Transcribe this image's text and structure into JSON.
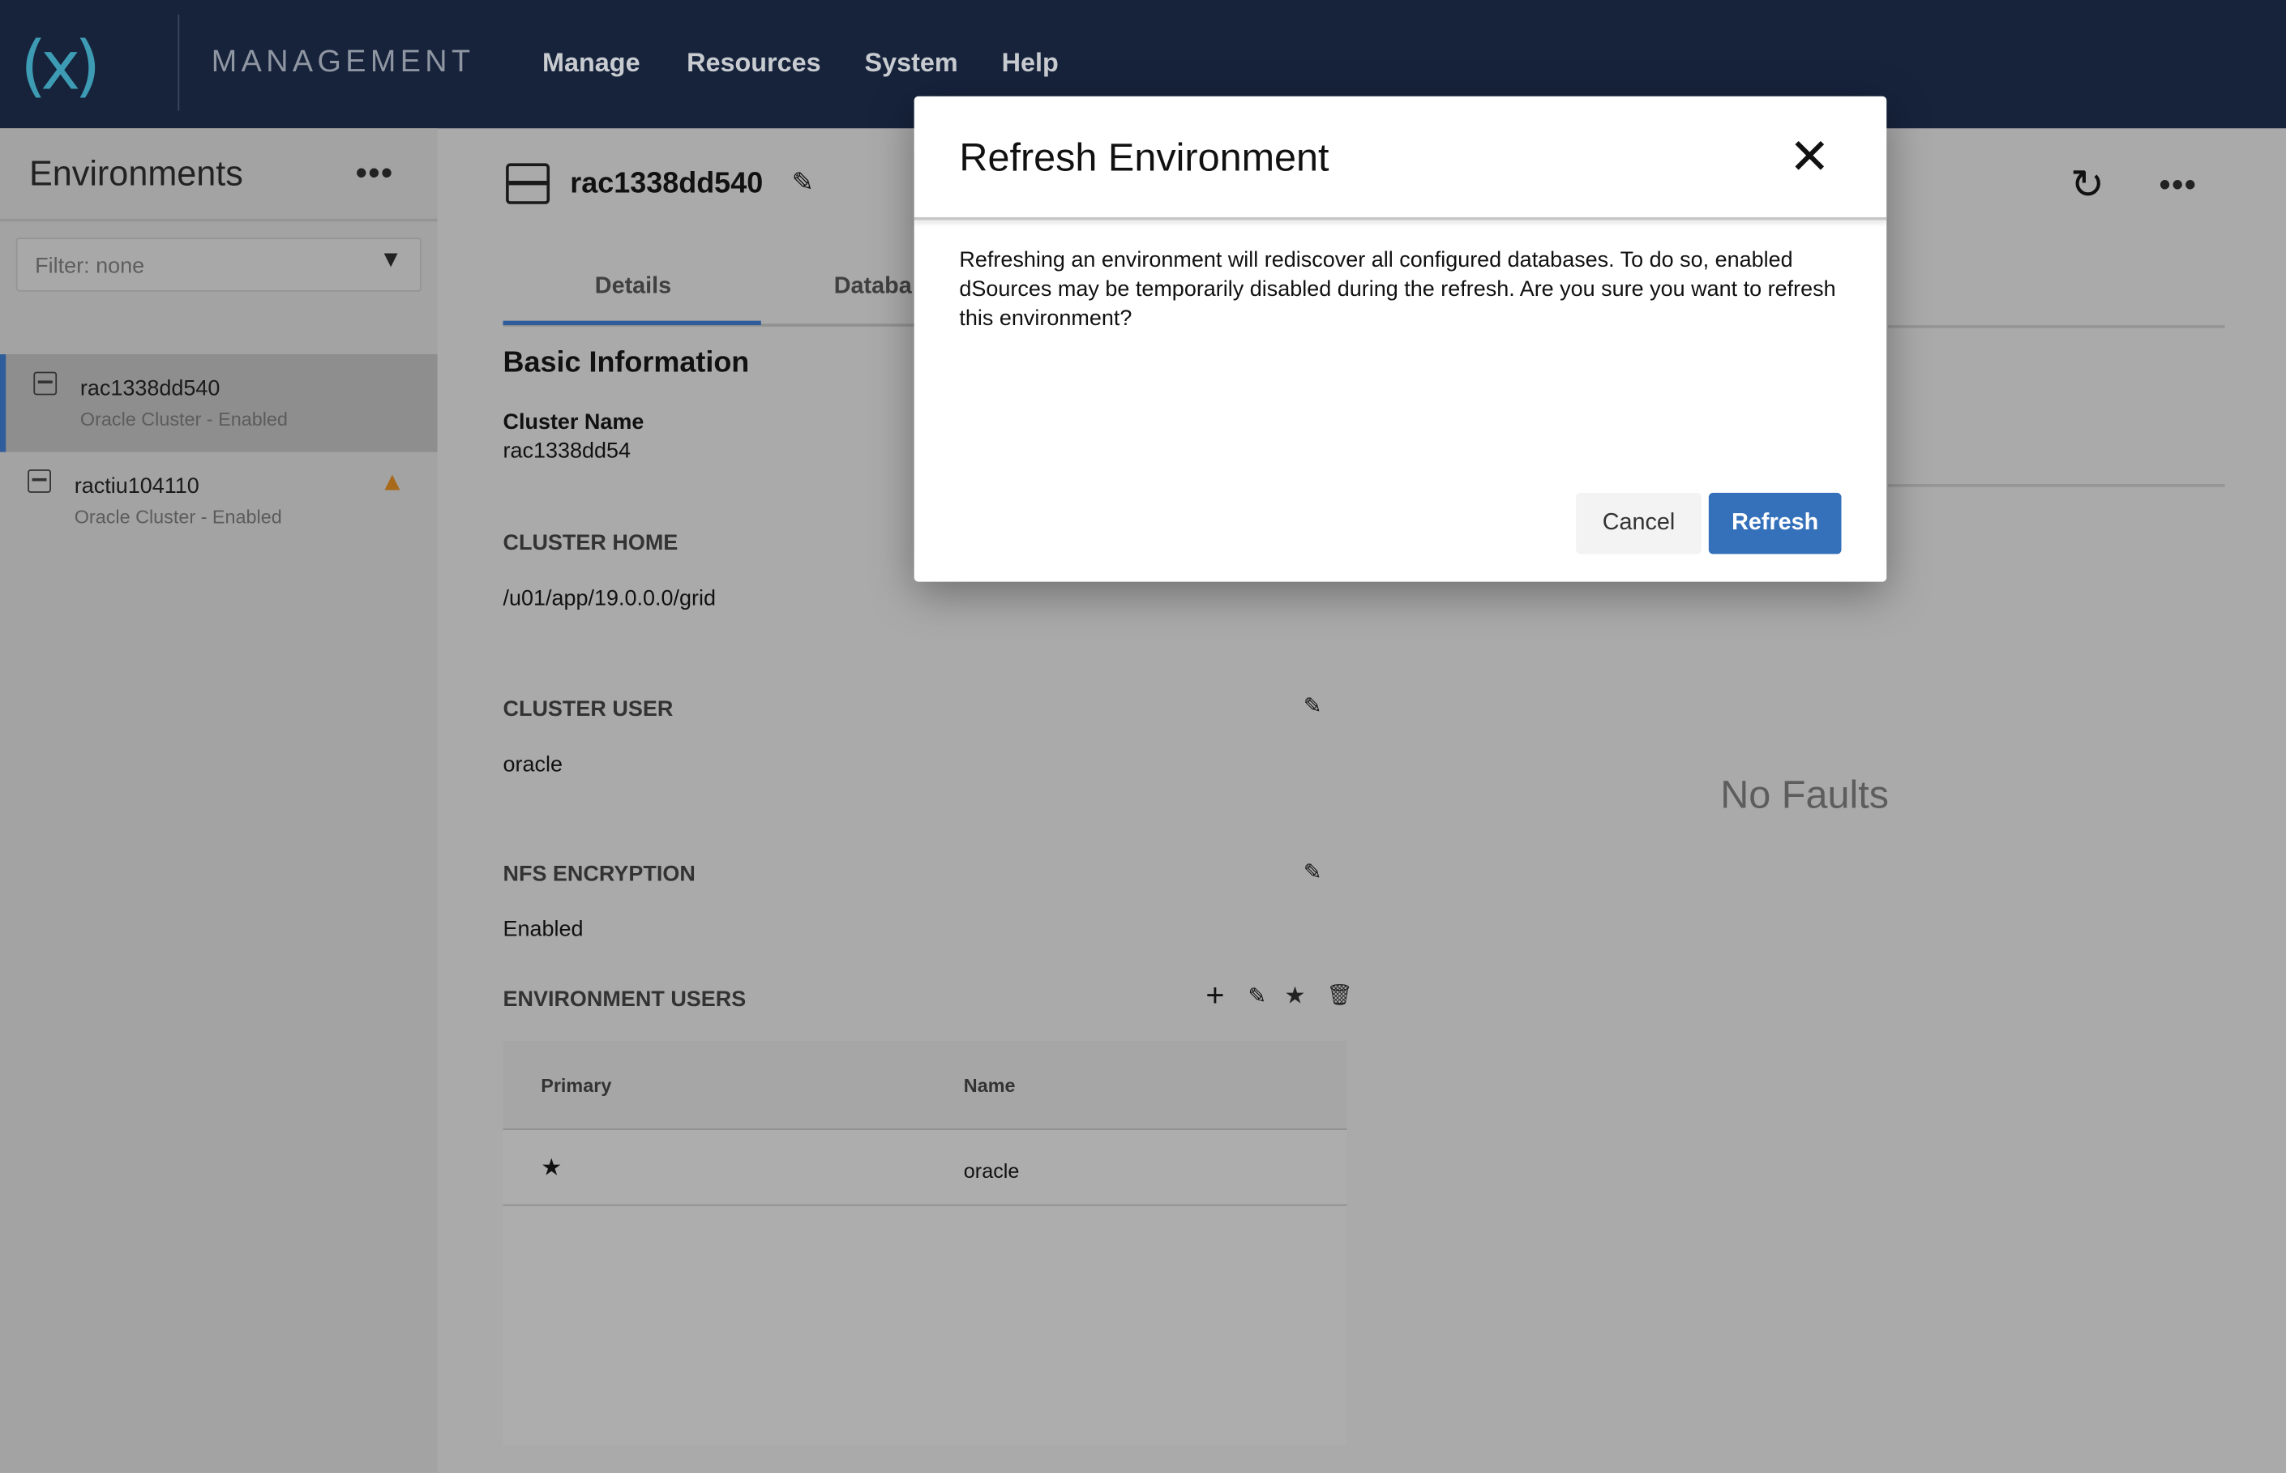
{
  "topbar": {
    "brand": "MANAGEMENT",
    "nav": [
      "Manage",
      "Resources",
      "System",
      "Help"
    ],
    "accent": "#3d9bb3"
  },
  "sidebar": {
    "title": "Environments",
    "more": "•••",
    "filter_placeholder": "Filter: none",
    "items": [
      {
        "name": "rac1338dd540",
        "status": "Oracle Cluster - Enabled",
        "selected": true,
        "warning": false
      },
      {
        "name": "ractiu104110",
        "status": "Oracle Cluster - Enabled",
        "selected": false,
        "warning": true
      }
    ]
  },
  "main": {
    "title": "rac1338dd540",
    "tabs": [
      "Details",
      "Databa"
    ],
    "section": "Basic Information",
    "cluster_name_label": "Cluster Name",
    "cluster_name": "rac1338dd54",
    "cluster_home_label": "CLUSTER HOME",
    "cluster_home": "/u01/app/19.0.0.0/grid",
    "cluster_user_label": "CLUSTER USER",
    "cluster_user": "oracle",
    "nfs_label": "NFS ENCRYPTION",
    "nfs": "Enabled",
    "users_label": "ENVIRONMENT USERS",
    "table": {
      "columns": [
        "Primary",
        "Name"
      ],
      "rows": [
        {
          "primary": "★",
          "name": "oracle"
        }
      ]
    },
    "more": "•••",
    "no_faults": "No Faults"
  },
  "modal": {
    "title": "Refresh Environment",
    "body": "Refreshing an environment will rediscover all configured databases. To do so, enabled dSources may be temporarily disabled during the refresh. Are you sure you want to refresh this environment?",
    "cancel": "Cancel",
    "confirm": "Refresh",
    "confirm_color": "#3571ba"
  }
}
